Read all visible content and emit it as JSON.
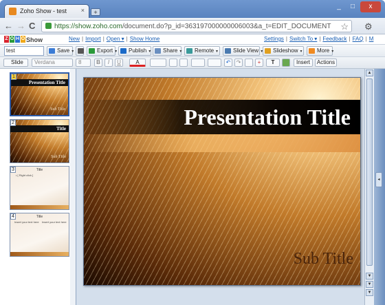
{
  "browser": {
    "tab_title": "Zoho Show - test",
    "tab_close": "×",
    "new_tab": "+",
    "url_host": "https://show.zoho.com",
    "url_path": "/document.do?p_id=363197000000006003&a_t=EDIT_DOCUMENT",
    "back": "←",
    "forward": "→",
    "reload": "C",
    "star": "☆",
    "wrench": "⚙",
    "win_min": "_",
    "win_max": "□",
    "win_close": "x"
  },
  "zoho": {
    "logo_letters": [
      "Z",
      "O",
      "H",
      "O"
    ],
    "logo_colors": [
      "#d9232d",
      "#2a9a3a",
      "#2a6fd0",
      "#f0a818"
    ],
    "product": "Show",
    "left_links": [
      "New",
      "Import",
      "Open ▾",
      "Show Home"
    ],
    "right_links": [
      "Settings",
      "Switch To ▾",
      "Feedback",
      "FAQ",
      "M"
    ]
  },
  "toolbar1": {
    "doc_name": "test",
    "buttons": [
      {
        "label": "Save",
        "icon": "save-icon"
      },
      {
        "label": "",
        "icon": "print-icon"
      },
      {
        "label": "Export",
        "icon": "export-icon"
      },
      {
        "label": "Publish",
        "icon": "publish-icon"
      },
      {
        "label": "Share",
        "icon": "share-icon"
      },
      {
        "label": "Remote",
        "icon": "remote-icon"
      },
      {
        "label": "Slide View",
        "icon": "slide-view-icon"
      },
      {
        "label": "Slideshow",
        "icon": "slideshow-icon"
      },
      {
        "label": "More",
        "icon": "more-icon"
      }
    ]
  },
  "toolbar2": {
    "slide_label": "Slide",
    "font_family": "Verdana",
    "font_size": "8",
    "bold": "B",
    "italic": "I",
    "underline": "U",
    "text_color": "A",
    "insert_label": "Insert",
    "actions_label": "Actions",
    "text_tool": "T"
  },
  "thumbnails": [
    {
      "num": "1",
      "title": "Presentation Title",
      "sub": "Sub Title",
      "style": "fibre-title"
    },
    {
      "num": "2",
      "title": "Title",
      "sub": "Sub Title",
      "style": "fibre-section"
    },
    {
      "num": "3",
      "title": "Title",
      "bullet": "• [ Right click ]",
      "style": "plain-bullet"
    },
    {
      "num": "4",
      "title": "Title",
      "col1": "Insert your text here",
      "col2": "Insert your text here",
      "style": "plain-two-col"
    }
  ],
  "slide": {
    "title": "Presentation Title",
    "subtitle": "Sub Title"
  },
  "scroll": {
    "up": "▲",
    "down": "▼",
    "pull": "◂"
  }
}
